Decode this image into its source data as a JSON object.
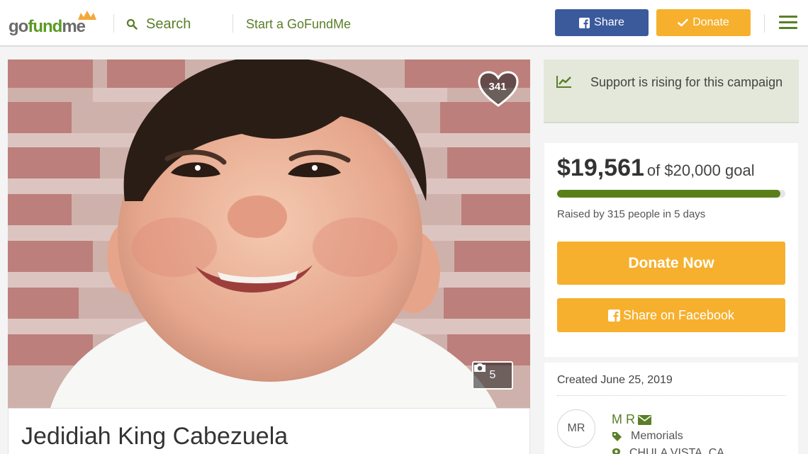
{
  "header": {
    "logo": "gofundme",
    "search_label": "Search",
    "start_label": "Start a GoFundMe",
    "share_label": "Share",
    "donate_label": "Donate"
  },
  "photo": {
    "hearts": "341",
    "photo_count": "5"
  },
  "campaign": {
    "title": "Jedidiah King Cabezuela"
  },
  "sidebar": {
    "rising_text": "Support is rising for this campaign",
    "amount": "$19,561",
    "goal": "of $20,000 goal",
    "progress_fraction": 0.978,
    "raised_text": "Raised by 315 people in 5 days",
    "donate_now_label": "Donate Now",
    "share_fb_label": "Share on Facebook",
    "created": "Created June 25, 2019",
    "avatar_initials": "MR",
    "organizer": "M R",
    "category": "Memorials",
    "location": "CHULA VISTA, CA"
  },
  "colors": {
    "brand_green": "#5a7f27",
    "facebook_blue": "#3a5a9c",
    "donate_orange": "#f6b02e"
  }
}
